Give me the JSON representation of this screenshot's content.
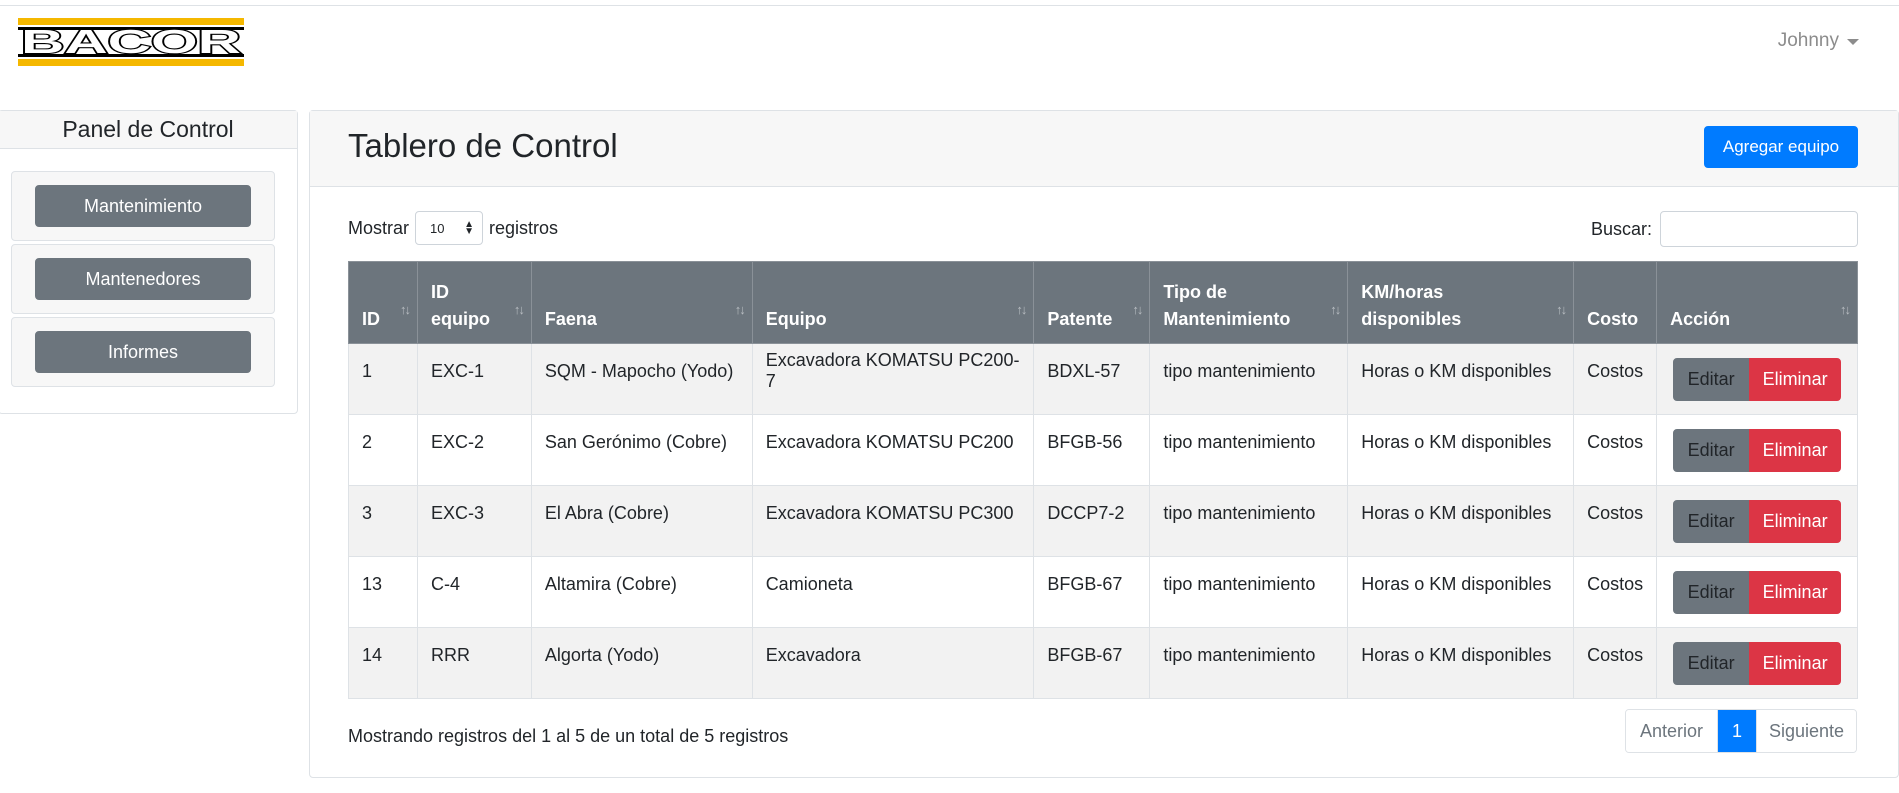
{
  "brand": {
    "logo_text": "BACOR",
    "colors": {
      "bar_top": "#f5b800",
      "bar_bottom": "#f5b800",
      "text": "#000000"
    }
  },
  "user": {
    "name": "Johnny",
    "menu_icon": "caret-down-icon"
  },
  "sidebar": {
    "title": "Panel de Control",
    "items": [
      {
        "label": "Mantenimiento"
      },
      {
        "label": "Mantenedores"
      },
      {
        "label": "Informes"
      }
    ]
  },
  "main": {
    "title": "Tablero de Control",
    "add_button": "Agregar equipo",
    "length_label_before": "Mostrar",
    "length_value": "10",
    "length_label_after": "registros",
    "search_label": "Buscar:",
    "search_value": "",
    "columns": [
      {
        "line1": "ID",
        "line2": ""
      },
      {
        "line1": "ID",
        "line2": "equipo"
      },
      {
        "line1": "Faena",
        "line2": ""
      },
      {
        "line1": "Equipo",
        "line2": ""
      },
      {
        "line1": "Patente",
        "line2": ""
      },
      {
        "line1": "Tipo de",
        "line2": "Mantenimiento"
      },
      {
        "line1": "KM/horas",
        "line2": "disponibles"
      },
      {
        "line1": "Costo",
        "line2": ""
      },
      {
        "line1": "Acción",
        "line2": ""
      }
    ],
    "rows": [
      {
        "id": "1",
        "id_equipo": "EXC-1",
        "faena": "SQM - Mapocho (Yodo)",
        "equipo": "Excavadora KOMATSU PC200-7",
        "patente": "BDXL-57",
        "tipo": "tipo mantenimiento",
        "km": "Horas o KM disponibles",
        "costo": "Costos"
      },
      {
        "id": "2",
        "id_equipo": "EXC-2",
        "faena": "San Gerónimo (Cobre)",
        "equipo": "Excavadora KOMATSU PC200",
        "patente": "BFGB-56",
        "tipo": "tipo mantenimiento",
        "km": "Horas o KM disponibles",
        "costo": "Costos"
      },
      {
        "id": "3",
        "id_equipo": "EXC-3",
        "faena": "El Abra (Cobre)",
        "equipo": "Excavadora KOMATSU PC300",
        "patente": "DCCP7-2",
        "tipo": "tipo mantenimiento",
        "km": "Horas o KM disponibles",
        "costo": "Costos"
      },
      {
        "id": "13",
        "id_equipo": "C-4",
        "faena": "Altamira (Cobre)",
        "equipo": "Camioneta",
        "patente": "BFGB-67",
        "tipo": "tipo mantenimiento",
        "km": "Horas o KM disponibles",
        "costo": "Costos"
      },
      {
        "id": "14",
        "id_equipo": "RRR",
        "faena": "Algorta (Yodo)",
        "equipo": "Excavadora",
        "patente": "BFGB-67",
        "tipo": "tipo mantenimiento",
        "km": "Horas o KM disponibles",
        "costo": "Costos"
      }
    ],
    "edit_label": "Editar",
    "delete_label": "Eliminar",
    "info": "Mostrando registros del 1 al 5 de un total de 5 registros",
    "pagination": {
      "prev": "Anterior",
      "current": "1",
      "next": "Siguiente"
    }
  },
  "colors": {
    "primary": "#007bff",
    "secondary": "#6c757d",
    "danger": "#dc3545"
  }
}
